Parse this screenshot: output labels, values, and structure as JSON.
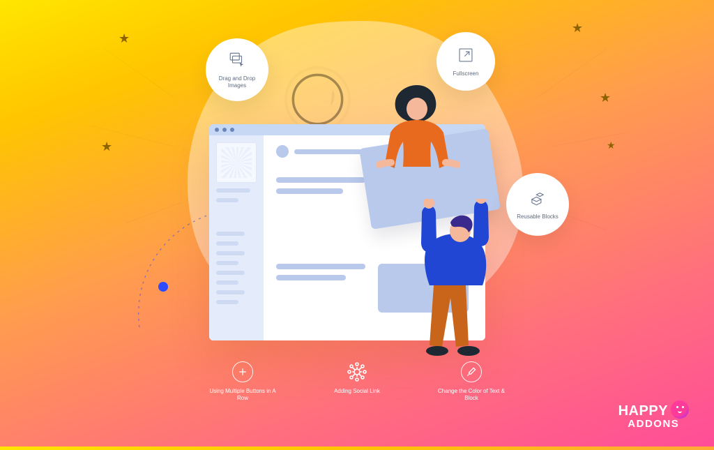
{
  "bubbles": {
    "drag_drop": {
      "label": "Drag and Drop Images"
    },
    "fullscreen": {
      "label": "Fullscreen"
    },
    "reusable": {
      "label": "Reusable Blocks"
    }
  },
  "features": {
    "multi_buttons": {
      "label": "Using Multiple Buttons in A Row"
    },
    "social_link": {
      "label": "Adding Social Link"
    },
    "change_color": {
      "label": "Change the Color of Text & Block"
    }
  },
  "brand": {
    "line1": "HAPPY",
    "line2": "ADDONS"
  }
}
